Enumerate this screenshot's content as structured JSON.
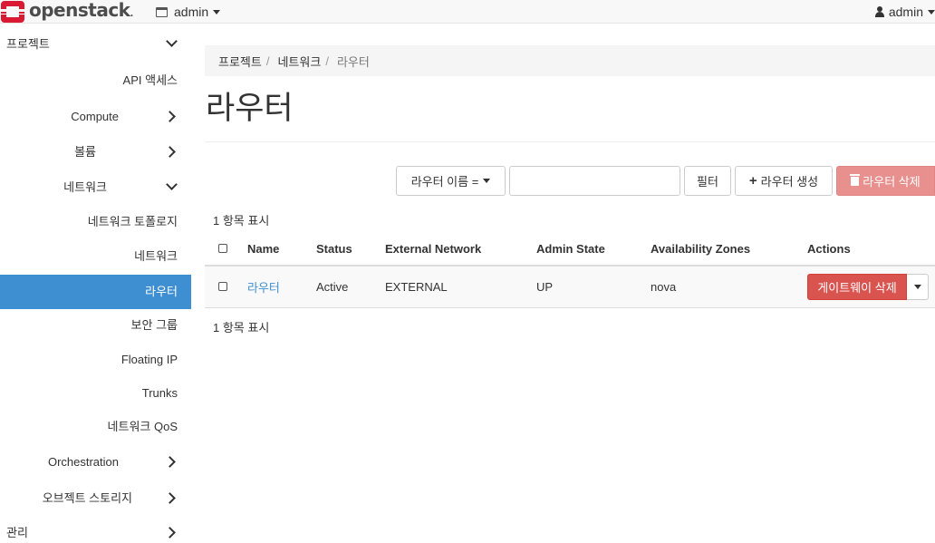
{
  "brand": {
    "name": "openstack",
    "suffix": "."
  },
  "header": {
    "project_label": "admin",
    "user_label": "admin"
  },
  "sidebar": {
    "items": [
      {
        "label": "프로젝트",
        "level": 0,
        "chevron": "down"
      },
      {
        "label": "API 액세스",
        "level": 2
      },
      {
        "label": "Compute",
        "level": 1,
        "chevron": "right"
      },
      {
        "label": "볼륨",
        "level": 1,
        "chevron": "right"
      },
      {
        "label": "네트워크",
        "level": 1,
        "chevron": "down"
      },
      {
        "label": "네트워크 토폴로지",
        "level": 2
      },
      {
        "label": "네트워크",
        "level": 2
      },
      {
        "label": "라우터",
        "level": 2,
        "active": true
      },
      {
        "label": "보안 그룹",
        "level": 2
      },
      {
        "label": "Floating IP",
        "level": 2
      },
      {
        "label": "Trunks",
        "level": 2
      },
      {
        "label": "네트워크 QoS",
        "level": 2
      },
      {
        "label": "Orchestration",
        "level": 1,
        "chevron": "right"
      },
      {
        "label": "오브젝트 스토리지",
        "level": 1,
        "chevron": "right"
      },
      {
        "label": "관리",
        "level": 0,
        "chevron": "right"
      }
    ]
  },
  "breadcrumb": {
    "items": [
      "프로젝트",
      "네트워크",
      "라우터"
    ],
    "separator": "/"
  },
  "page": {
    "title": "라우터"
  },
  "toolbar": {
    "filter_field": "라우터 이름 =",
    "filter_value": "",
    "filter_button": "필터",
    "create_button": "라우터 생성",
    "delete_button": "라우터 삭제"
  },
  "table": {
    "count_top": "1 항목 표시",
    "count_bottom": "1 항목 표시",
    "columns": [
      "Name",
      "Status",
      "External Network",
      "Admin State",
      "Availability Zones",
      "Actions"
    ],
    "rows": [
      {
        "name": "라우터",
        "status": "Active",
        "external_network": "EXTERNAL",
        "admin_state": "UP",
        "availability_zones": "nova",
        "action": "게이트웨이 삭제"
      }
    ]
  },
  "colors": {
    "accent": "#3e8fd1",
    "danger": "#d9534f",
    "danger_disabled": "#e8908e",
    "logo": "#da1a32"
  }
}
